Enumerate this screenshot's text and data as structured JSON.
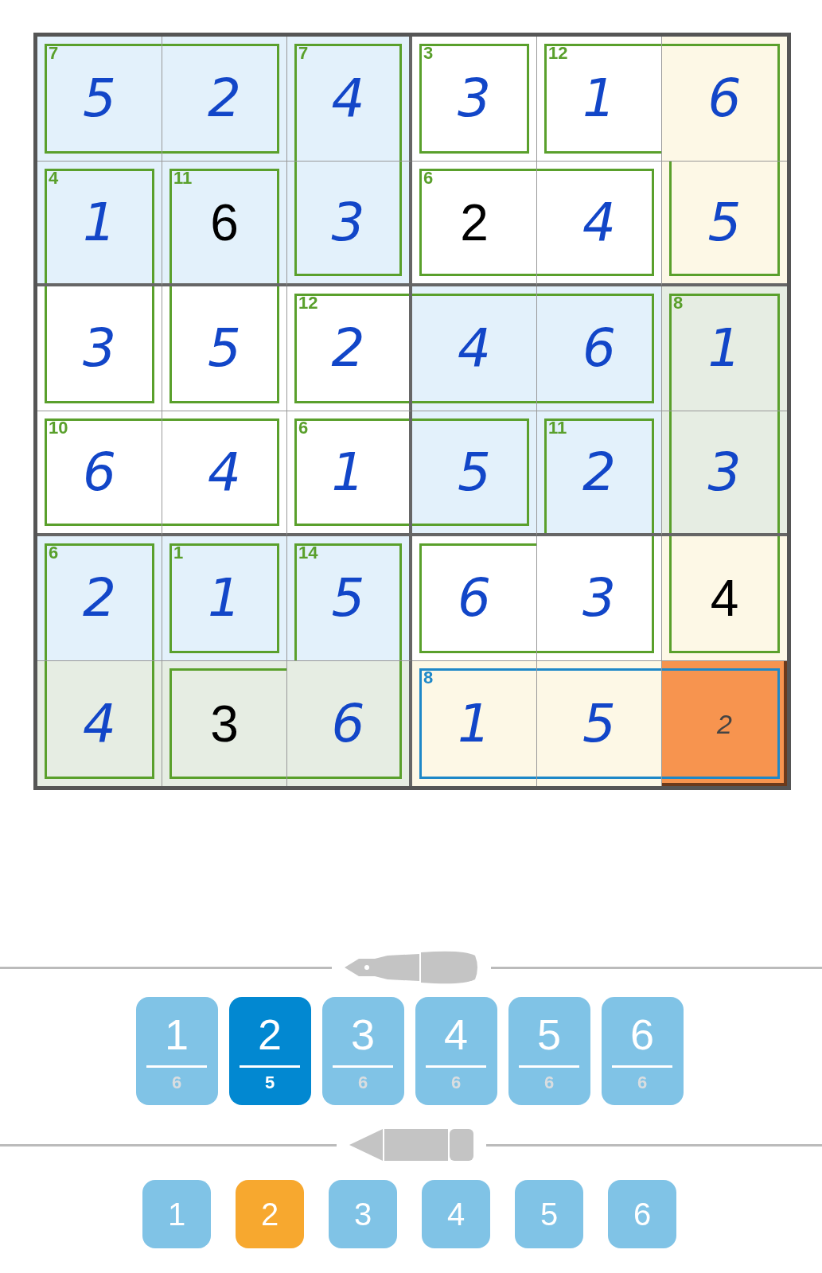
{
  "grid": {
    "rows": [
      {
        "cells": [
          {
            "value": "5",
            "kind": "entered",
            "color": "#e3f1fb",
            "cage_sum": "7",
            "cage_selected": false,
            "selected": false,
            "walls": {
              "top": true,
              "right": false,
              "bottom": true,
              "left": true
            }
          },
          {
            "value": "2",
            "kind": "entered",
            "color": "#e3f1fb",
            "cage_selected": false,
            "selected": false,
            "walls": {
              "top": true,
              "right": true,
              "bottom": true,
              "left": false
            }
          },
          {
            "value": "4",
            "kind": "entered",
            "color": "#e3f1fb",
            "cage_sum": "7",
            "cage_selected": false,
            "selected": false,
            "walls": {
              "top": true,
              "right": true,
              "bottom": false,
              "left": true
            }
          },
          {
            "value": "3",
            "kind": "entered",
            "color": "#ffffff",
            "cage_sum": "3",
            "cage_selected": false,
            "selected": false,
            "walls": {
              "top": true,
              "right": true,
              "bottom": true,
              "left": true
            }
          },
          {
            "value": "1",
            "kind": "entered",
            "color": "#ffffff",
            "cage_sum": "12",
            "cage_selected": false,
            "selected": false,
            "walls": {
              "top": true,
              "right": false,
              "bottom": true,
              "left": true
            }
          },
          {
            "value": "6",
            "kind": "entered",
            "color": "#fdf8e6",
            "cage_selected": false,
            "selected": false,
            "walls": {
              "top": true,
              "right": true,
              "bottom": false,
              "left": false
            }
          }
        ]
      },
      {
        "cells": [
          {
            "value": "1",
            "kind": "entered",
            "color": "#e3f1fb",
            "cage_sum": "4",
            "cage_selected": false,
            "selected": false,
            "walls": {
              "top": true,
              "right": true,
              "bottom": false,
              "left": true
            }
          },
          {
            "value": "6",
            "kind": "given",
            "color": "#e3f1fb",
            "cage_sum": "11",
            "cage_selected": false,
            "selected": false,
            "walls": {
              "top": true,
              "right": true,
              "bottom": false,
              "left": true
            }
          },
          {
            "value": "3",
            "kind": "entered",
            "color": "#e3f1fb",
            "cage_selected": false,
            "selected": false,
            "walls": {
              "top": false,
              "right": true,
              "bottom": true,
              "left": true
            }
          },
          {
            "value": "2",
            "kind": "given",
            "color": "#ffffff",
            "cage_sum": "6",
            "cage_selected": false,
            "selected": false,
            "walls": {
              "top": true,
              "right": false,
              "bottom": true,
              "left": true
            }
          },
          {
            "value": "4",
            "kind": "entered",
            "color": "#ffffff",
            "cage_selected": false,
            "selected": false,
            "walls": {
              "top": true,
              "right": true,
              "bottom": true,
              "left": false
            }
          },
          {
            "value": "5",
            "kind": "entered",
            "color": "#fdf8e6",
            "cage_selected": false,
            "selected": false,
            "walls": {
              "top": false,
              "right": true,
              "bottom": true,
              "left": true
            }
          }
        ]
      },
      {
        "cells": [
          {
            "value": "3",
            "kind": "entered",
            "color": "#ffffff",
            "cage_selected": false,
            "selected": false,
            "walls": {
              "top": false,
              "right": true,
              "bottom": true,
              "left": true
            }
          },
          {
            "value": "5",
            "kind": "entered",
            "color": "#ffffff",
            "cage_selected": false,
            "selected": false,
            "walls": {
              "top": false,
              "right": true,
              "bottom": true,
              "left": true
            }
          },
          {
            "value": "2",
            "kind": "entered",
            "color": "#ffffff",
            "cage_sum": "12",
            "cage_selected": false,
            "selected": false,
            "walls": {
              "top": true,
              "right": false,
              "bottom": true,
              "left": true
            }
          },
          {
            "value": "4",
            "kind": "entered",
            "color": "#e3f1fb",
            "cage_selected": false,
            "selected": false,
            "walls": {
              "top": true,
              "right": false,
              "bottom": true,
              "left": false
            }
          },
          {
            "value": "6",
            "kind": "entered",
            "color": "#e3f1fb",
            "cage_selected": false,
            "selected": false,
            "walls": {
              "top": true,
              "right": true,
              "bottom": true,
              "left": false
            }
          },
          {
            "value": "1",
            "kind": "entered",
            "color": "#e6ede3",
            "cage_sum": "8",
            "cage_selected": false,
            "selected": false,
            "walls": {
              "top": true,
              "right": true,
              "bottom": false,
              "left": true
            }
          }
        ]
      },
      {
        "cells": [
          {
            "value": "6",
            "kind": "entered",
            "color": "#ffffff",
            "cage_sum": "10",
            "cage_selected": false,
            "selected": false,
            "walls": {
              "top": true,
              "right": false,
              "bottom": true,
              "left": true
            }
          },
          {
            "value": "4",
            "kind": "entered",
            "color": "#ffffff",
            "cage_selected": false,
            "selected": false,
            "walls": {
              "top": true,
              "right": true,
              "bottom": true,
              "left": false
            }
          },
          {
            "value": "1",
            "kind": "entered",
            "color": "#ffffff",
            "cage_sum": "6",
            "cage_selected": false,
            "selected": false,
            "walls": {
              "top": true,
              "right": false,
              "bottom": true,
              "left": true
            }
          },
          {
            "value": "5",
            "kind": "entered",
            "color": "#e3f1fb",
            "cage_selected": false,
            "selected": false,
            "walls": {
              "top": true,
              "right": true,
              "bottom": true,
              "left": false
            }
          },
          {
            "value": "2",
            "kind": "entered",
            "color": "#e3f1fb",
            "cage_sum": "11",
            "cage_selected": false,
            "selected": false,
            "walls": {
              "top": true,
              "right": true,
              "bottom": false,
              "left": true
            }
          },
          {
            "value": "3",
            "kind": "entered",
            "color": "#e6ede3",
            "cage_selected": false,
            "selected": false,
            "walls": {
              "top": false,
              "right": true,
              "bottom": false,
              "left": true
            }
          }
        ]
      },
      {
        "cells": [
          {
            "value": "2",
            "kind": "entered",
            "color": "#e3f1fb",
            "cage_sum": "6",
            "cage_selected": false,
            "selected": false,
            "walls": {
              "top": true,
              "right": true,
              "bottom": false,
              "left": true
            }
          },
          {
            "value": "1",
            "kind": "entered",
            "color": "#e3f1fb",
            "cage_sum": "1",
            "cage_selected": false,
            "selected": false,
            "walls": {
              "top": true,
              "right": true,
              "bottom": true,
              "left": true
            }
          },
          {
            "value": "5",
            "kind": "entered",
            "color": "#e3f1fb",
            "cage_sum": "14",
            "cage_selected": false,
            "selected": false,
            "walls": {
              "top": true,
              "right": true,
              "bottom": false,
              "left": true
            }
          },
          {
            "value": "6",
            "kind": "entered",
            "color": "#ffffff",
            "cage_selected": false,
            "selected": false,
            "walls": {
              "top": true,
              "right": false,
              "bottom": true,
              "left": true
            }
          },
          {
            "value": "3",
            "kind": "entered",
            "color": "#ffffff",
            "cage_selected": false,
            "selected": false,
            "walls": {
              "top": false,
              "right": true,
              "bottom": true,
              "left": false
            }
          },
          {
            "value": "4",
            "kind": "given",
            "color": "#fdf8e6",
            "cage_selected": false,
            "selected": false,
            "walls": {
              "top": false,
              "right": true,
              "bottom": true,
              "left": true
            }
          }
        ]
      },
      {
        "cells": [
          {
            "value": "4",
            "kind": "entered",
            "color": "#e6ede3",
            "cage_selected": false,
            "selected": false,
            "walls": {
              "top": false,
              "right": true,
              "bottom": true,
              "left": true
            }
          },
          {
            "value": "3",
            "kind": "given",
            "color": "#e6ede3",
            "cage_selected": false,
            "selected": false,
            "walls": {
              "top": true,
              "right": false,
              "bottom": true,
              "left": true
            }
          },
          {
            "value": "6",
            "kind": "entered",
            "color": "#e6ede3",
            "cage_selected": false,
            "selected": false,
            "walls": {
              "top": false,
              "right": true,
              "bottom": true,
              "left": false
            }
          },
          {
            "value": "1",
            "kind": "entered",
            "color": "#fdf8e6",
            "cage_sum": "8",
            "cage_selected": true,
            "selected": false,
            "walls": {
              "top": true,
              "right": false,
              "bottom": true,
              "left": true
            }
          },
          {
            "value": "5",
            "kind": "entered",
            "color": "#fdf8e6",
            "cage_selected": true,
            "selected": false,
            "walls": {
              "top": true,
              "right": false,
              "bottom": true,
              "left": false
            }
          },
          {
            "value": "2",
            "kind": "note",
            "color": "#f7944f",
            "cage_selected": true,
            "selected": true,
            "walls": {
              "top": true,
              "right": true,
              "bottom": true,
              "left": false
            }
          }
        ]
      }
    ]
  },
  "pen_buttons": [
    {
      "digit": "1",
      "count": "6",
      "selected": false
    },
    {
      "digit": "2",
      "count": "5",
      "selected": true
    },
    {
      "digit": "3",
      "count": "6",
      "selected": false
    },
    {
      "digit": "4",
      "count": "6",
      "selected": false
    },
    {
      "digit": "5",
      "count": "6",
      "selected": false
    },
    {
      "digit": "6",
      "count": "6",
      "selected": false
    }
  ],
  "pencil_buttons": [
    {
      "digit": "1",
      "selected": false
    },
    {
      "digit": "2",
      "selected": true
    },
    {
      "digit": "3",
      "selected": false
    },
    {
      "digit": "4",
      "selected": false
    },
    {
      "digit": "5",
      "selected": false
    },
    {
      "digit": "6",
      "selected": false
    }
  ]
}
